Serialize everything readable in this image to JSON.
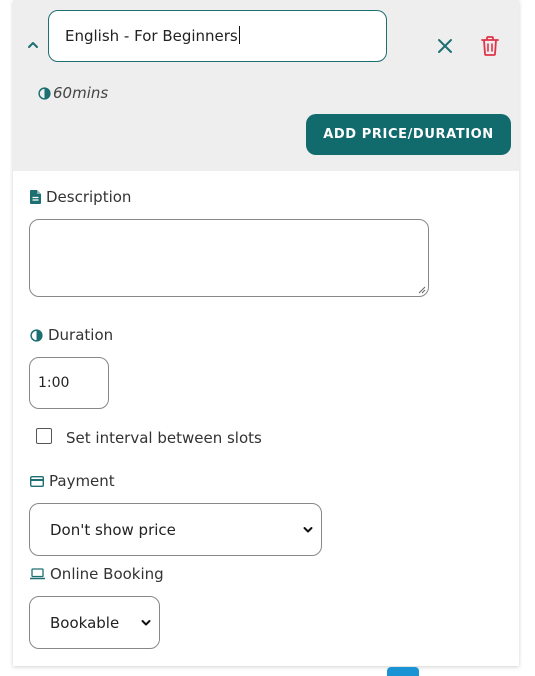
{
  "header": {
    "name_value": "English - For Beginners",
    "duration_summary": "60mins",
    "add_price_label": "ADD PRICE/DURATION"
  },
  "description": {
    "label": "Description",
    "value": ""
  },
  "duration": {
    "label": "Duration",
    "value": "1:00"
  },
  "interval": {
    "label": "Set interval between slots",
    "checked": false
  },
  "payment": {
    "label": "Payment",
    "selected": "Don't show price"
  },
  "online_booking": {
    "label": "Online Booking",
    "selected": "Bookable"
  },
  "colors": {
    "accent": "#116a6c",
    "danger": "#e0344a",
    "header_bg": "#eeeeee",
    "scroll_tab": "#1a93d4"
  },
  "icons": {
    "collapse": "chevron-up-icon",
    "close": "close-icon",
    "delete": "trash-icon",
    "duration": "clock-half-icon",
    "description": "document-icon",
    "payment": "credit-card-icon",
    "online_booking": "laptop-icon"
  }
}
